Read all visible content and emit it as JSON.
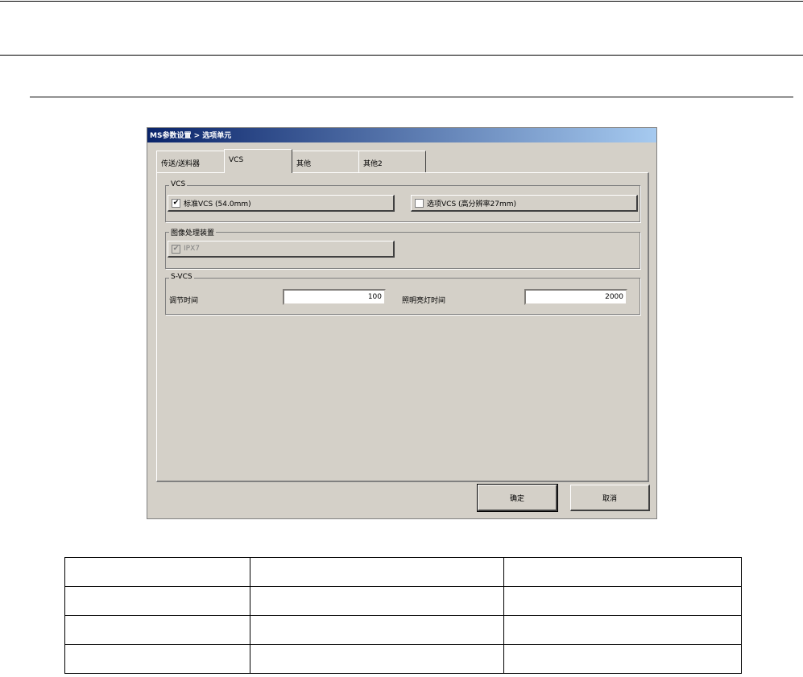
{
  "dialog": {
    "title": "MS参数设置 > 选项单元",
    "tabs": [
      {
        "label": "传送/送料器"
      },
      {
        "label": "VCS"
      },
      {
        "label": "其他"
      },
      {
        "label": "其他2"
      }
    ],
    "vcs_group": {
      "label": "VCS",
      "standard": {
        "label": "标准VCS (54.0mm)",
        "checked": true
      },
      "optional": {
        "label": "选项VCS (高分辨率27mm)",
        "checked": false
      }
    },
    "image_group": {
      "label": "图像处理装置",
      "ipx": {
        "label": "IPX7",
        "checked": true,
        "disabled": true
      }
    },
    "svcs_group": {
      "label": "S-VCS",
      "adjust_time_label": "调节时间",
      "adjust_time_value": "100",
      "light_time_label": "照明亮灯时间",
      "light_time_value": "2000"
    },
    "ok_label": "确定",
    "cancel_label": "取消"
  },
  "table": {
    "rows": [
      [
        "",
        "",
        ""
      ],
      [
        "",
        "",
        ""
      ],
      [
        "",
        "",
        ""
      ],
      [
        "",
        "",
        ""
      ]
    ]
  }
}
